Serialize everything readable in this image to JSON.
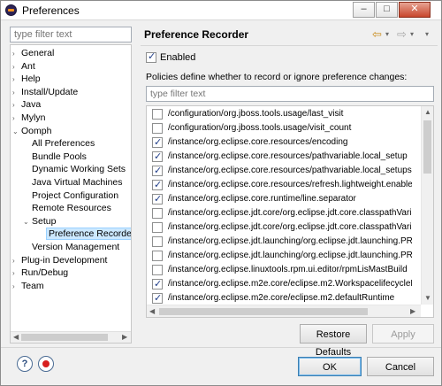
{
  "window": {
    "title": "Preferences",
    "min": "–",
    "max": "□",
    "close": "✕"
  },
  "left": {
    "filter_placeholder": "type filter text",
    "tree": [
      {
        "label": "General",
        "expander": "›"
      },
      {
        "label": "Ant",
        "expander": "›"
      },
      {
        "label": "Help",
        "expander": "›"
      },
      {
        "label": "Install/Update",
        "expander": "›"
      },
      {
        "label": "Java",
        "expander": "›"
      },
      {
        "label": "Mylyn",
        "expander": "›"
      },
      {
        "label": "Oomph",
        "expander": "⌄"
      },
      {
        "label": "All Preferences",
        "expander": ""
      },
      {
        "label": "Bundle Pools",
        "expander": ""
      },
      {
        "label": "Dynamic Working Sets",
        "expander": ""
      },
      {
        "label": "Java Virtual Machines",
        "expander": ""
      },
      {
        "label": "Project Configuration",
        "expander": ""
      },
      {
        "label": "Remote Resources",
        "expander": ""
      },
      {
        "label": "Setup",
        "expander": "⌄"
      },
      {
        "label": "Preference Recorder",
        "expander": ""
      },
      {
        "label": "Version Management",
        "expander": ""
      },
      {
        "label": "Plug-in Development",
        "expander": "›"
      },
      {
        "label": "Run/Debug",
        "expander": "›"
      },
      {
        "label": "Team",
        "expander": "›"
      }
    ]
  },
  "right": {
    "title": "Preference Recorder",
    "back_icon": "⇦",
    "forward_icon": "⇨",
    "menu_icon": "▾",
    "enabled_label": "Enabled",
    "enabled_checked": true,
    "policy_text": "Policies define whether to record or ignore preference changes:",
    "filter_placeholder": "type filter text",
    "rows": [
      {
        "path": "/configuration/org.jboss.tools.usage/last_visit",
        "checked": false
      },
      {
        "path": "/configuration/org.jboss.tools.usage/visit_count",
        "checked": false
      },
      {
        "path": "/instance/org.eclipse.core.resources/encoding",
        "checked": true
      },
      {
        "path": "/instance/org.eclipse.core.resources/pathvariable.local_setup",
        "checked": true
      },
      {
        "path": "/instance/org.eclipse.core.resources/pathvariable.local_setups",
        "checked": true
      },
      {
        "path": "/instance/org.eclipse.core.resources/refresh.lightweight.enabled",
        "checked": true
      },
      {
        "path": "/instance/org.eclipse.core.runtime/line.separator",
        "checked": true
      },
      {
        "path": "/instance/org.eclipse.jdt.core/org.eclipse.jdt.core.classpathVariab...",
        "checked": false
      },
      {
        "path": "/instance/org.eclipse.jdt.core/org.eclipse.jdt.core.classpathVariab...",
        "checked": false
      },
      {
        "path": "/instance/org.eclipse.jdt.launching/org.eclipse.jdt.launching.PRE...",
        "checked": false
      },
      {
        "path": "/instance/org.eclipse.jdt.launching/org.eclipse.jdt.launching.PRE...",
        "checked": false
      },
      {
        "path": "/instance/org.eclipse.linuxtools.rpm.ui.editor/rpmLisMastBuild",
        "checked": false
      },
      {
        "path": "/instance/org.eclipse.m2e.core/eclipse.m2.WorkspacelifecycleMa...",
        "checked": true
      },
      {
        "path": "/instance/org.eclipse.m2e.core/eclipse.m2.defaultRuntime",
        "checked": true
      }
    ],
    "restore_defaults": "Restore Defaults",
    "apply": "Apply"
  },
  "footer": {
    "help_icon": "?",
    "ok": "OK",
    "cancel": "Cancel"
  }
}
